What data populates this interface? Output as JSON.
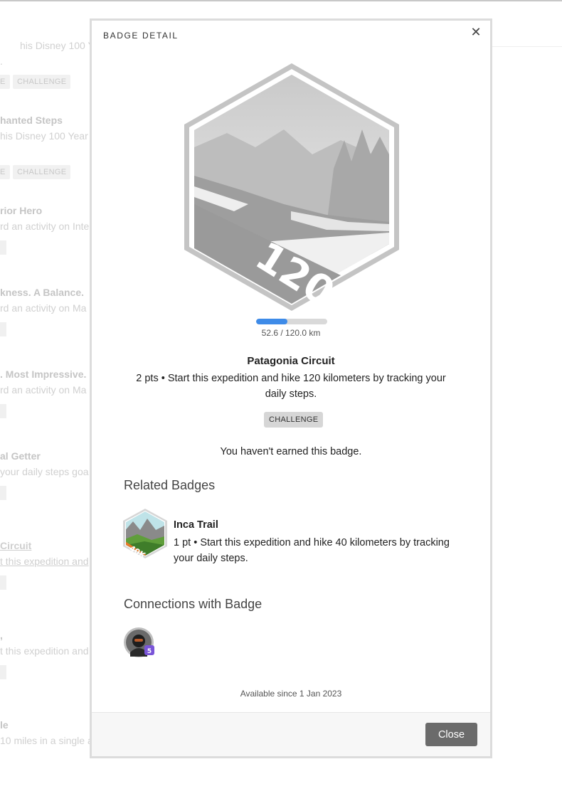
{
  "background": {
    "items": [
      {
        "title": "",
        "desc": "his Disney 100 Year"
      },
      {
        "title": "hanted Steps",
        "desc": "his Disney 100 Year"
      },
      {
        "title": "rior Hero",
        "desc": "rd an activity on Inte"
      },
      {
        "title": "kness. A Balance.",
        "desc": "rd an activity on Ma"
      },
      {
        "title": ". Most Impressive.",
        "desc": "rd an activity on Ma"
      },
      {
        "title": "al Getter",
        "desc": "your daily steps goa"
      },
      {
        "title": "Circuit",
        "desc": "t this expedition and"
      },
      {
        "title": "",
        "desc": "t this expedition and"
      },
      {
        "title": "le",
        "desc": "10 miles in a single a"
      }
    ],
    "tags": [
      "E",
      "CHALLENGE"
    ]
  },
  "modal": {
    "title": "BADGE DETAIL",
    "close_icon": "close-icon",
    "badge": {
      "image_label": "120K",
      "progress_fraction": 0.438,
      "progress_text": "52.6 / 120.0 km",
      "name": "Patagonia Circuit",
      "description": "2 pts • Start this expedition and hike 120 kilometers by tracking your daily steps.",
      "tag": "CHALLENGE",
      "status": "You haven't earned this badge."
    },
    "related": {
      "heading": "Related Badges",
      "items": [
        {
          "image_label": "40K",
          "name": "Inca Trail",
          "description": "1 pt • Start this expedition and hike 40 kilometers by tracking your daily steps."
        }
      ]
    },
    "connections": {
      "heading": "Connections with Badge",
      "avatar_level": "5"
    },
    "available": "Available since 1 Jan 2023",
    "close_label": "Close"
  },
  "colors": {
    "progress": "#3e8be8",
    "close_button": "#6b6b6b",
    "level_badge": "#7a55d8",
    "related_badge_accent": "#e8792a"
  }
}
